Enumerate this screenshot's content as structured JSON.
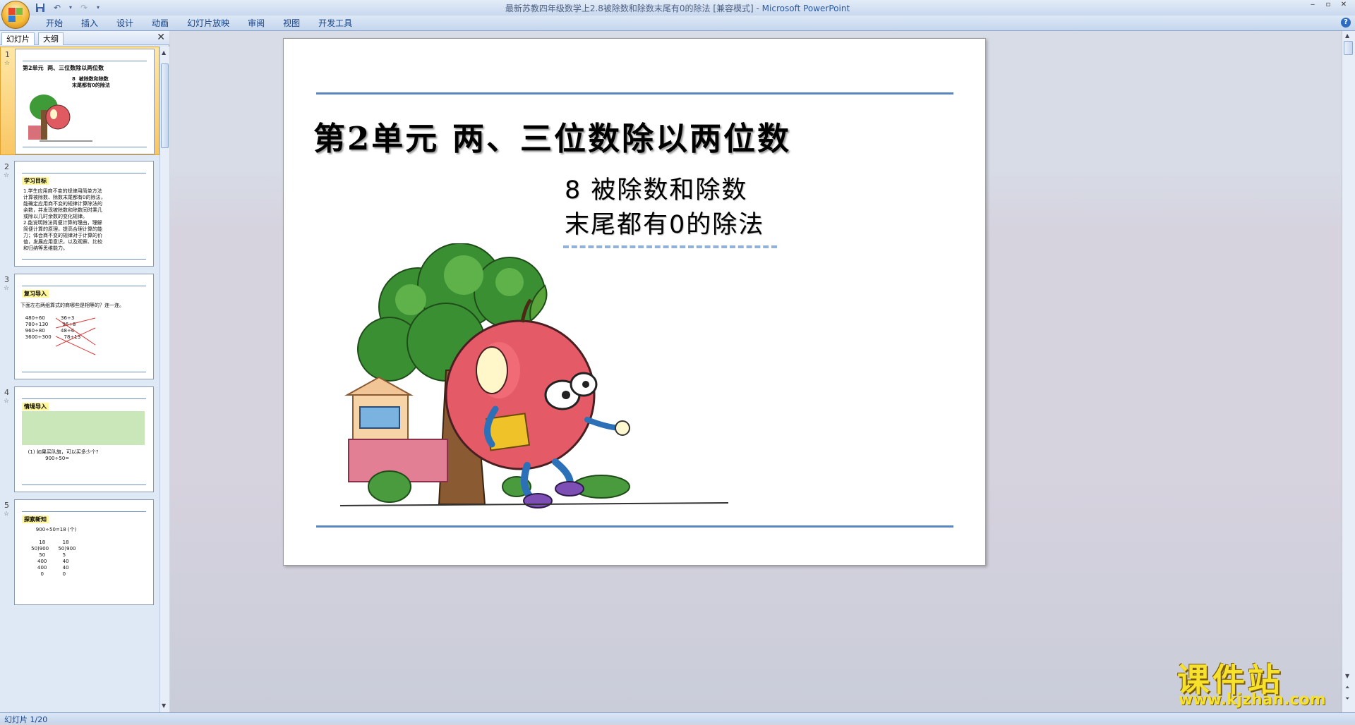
{
  "window": {
    "title_doc": "最新苏教四年级数学上2.8被除数和除数末尾有0的除法 [兼容模式] - ",
    "title_app": "Microsoft PowerPoint"
  },
  "ribbon": {
    "tabs": [
      "开始",
      "插入",
      "设计",
      "动画",
      "幻灯片放映",
      "审阅",
      "视图",
      "开发工具"
    ]
  },
  "left_pane": {
    "tab_slides": "幻灯片",
    "tab_outline": "大纲",
    "thumbnails": [
      {
        "num": "1",
        "title": "第2单元  两、三位数除以两位数",
        "text": "8  被除数和除数\n末尾都有0的除法",
        "selected": true
      },
      {
        "num": "2",
        "title": "学习目标",
        "text": "1.学生应用商不变的规律用简单方法\n计算被除数、除数末尾都有0的除法，\n能确定应用商不变的规律计算除法的\n余数，并发现被除数和除数同时乘几\n或除以几时余数的变化规律。\n2.能说明除法简便计算的理由，理解\n简便计算的原理，提高合理计算的能\n力；体会商不变的规律对于计算的价\n值，发展应用意识，以及观察、比较\n和归纳等思维能力。",
        "selected": false
      },
      {
        "num": "3",
        "title": "复习导入",
        "text": "下面左右两组算式的商哪些是相等的？连一连。\n\n   480÷60          36÷3\n   780÷130         96÷8\n   960÷80          48÷6\n   3600÷300        78÷13",
        "selected": false
      },
      {
        "num": "4",
        "title": "情境导入",
        "text": "\n\n\n\n\n\n   (1) 如果买队旗，可以买多少个?\n              900÷50=",
        "selected": false
      },
      {
        "num": "5",
        "title": "探索新知",
        "text": "        900÷50=18 (个)\n\n          18           18\n     50)900      50)900\n          50           5\n         400          40\n         400          40\n           0            0",
        "selected": false
      }
    ]
  },
  "slide": {
    "title": "第2单元  两、三位数除以两位数",
    "subtitle_line1": "8   被除数和除数",
    "subtitle_line2": "末尾都有0的除法"
  },
  "status": {
    "text": "幻灯片 1/20"
  },
  "watermark": {
    "top": "课件站",
    "url": "www.kjzhan.com"
  },
  "colors": {
    "accent_rule": "#5b86bf",
    "selected_thumb": "#f9c764",
    "watermark": "#f6e12c"
  }
}
